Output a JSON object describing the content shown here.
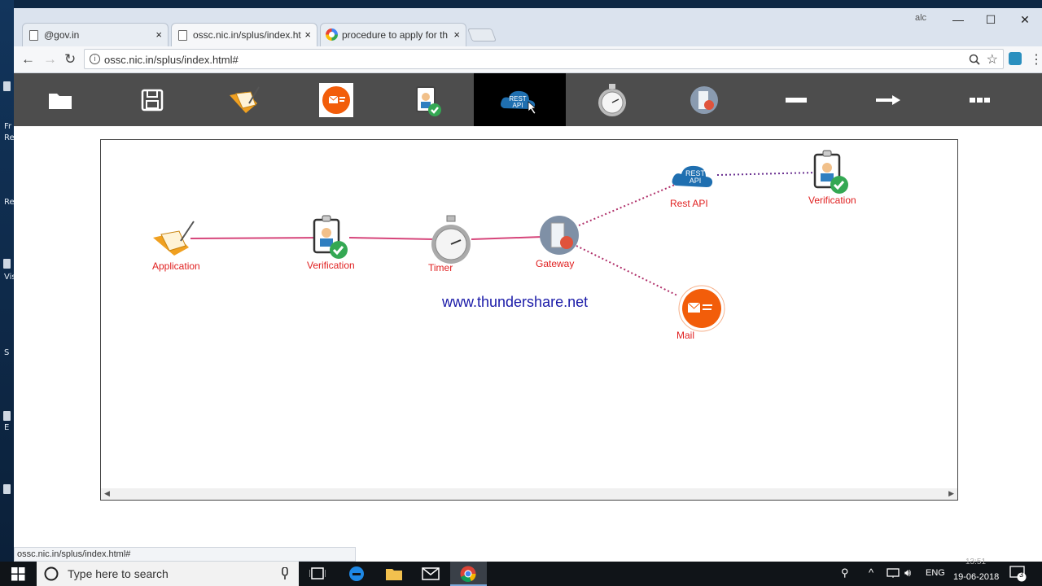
{
  "desktop": {
    "labels": [
      "Fr",
      "Re",
      "Re",
      "Vis",
      "S",
      "E"
    ]
  },
  "browser": {
    "tabs": [
      {
        "title": "@gov.in",
        "close": "×"
      },
      {
        "title": "ossc.nic.in/splus/index.ht",
        "close": "×"
      },
      {
        "title": "procedure to apply for th",
        "close": "×"
      }
    ],
    "window_controls": {
      "user": "alc",
      "minimize": "—",
      "maximize": "☐",
      "close": "✕"
    },
    "url": "ossc.nic.in/splus/index.html#",
    "status_url": "ossc.nic.in/splus/index.html#"
  },
  "toolbar": {
    "tools": [
      {
        "name": "open-folder",
        "icon": "folder-icon"
      },
      {
        "name": "save",
        "icon": "floppy-disk-icon"
      },
      {
        "name": "application",
        "icon": "folder-form-icon"
      },
      {
        "name": "mail",
        "icon": "mail-icon"
      },
      {
        "name": "verification",
        "icon": "badge-check-icon"
      },
      {
        "name": "rest-api",
        "icon": "rest-api-cloud-icon",
        "text": "REST API",
        "selected": true
      },
      {
        "name": "timer",
        "icon": "stopwatch-icon"
      },
      {
        "name": "gateway",
        "icon": "gateway-icon"
      },
      {
        "name": "line",
        "icon": "line-icon"
      },
      {
        "name": "arrow",
        "icon": "arrow-right-icon"
      },
      {
        "name": "dotted-line",
        "icon": "dotted-line-icon"
      }
    ]
  },
  "diagram": {
    "nodes": [
      {
        "id": "application",
        "label": "Application"
      },
      {
        "id": "verification1",
        "label": "Verification"
      },
      {
        "id": "timer",
        "label": "Timer"
      },
      {
        "id": "gateway",
        "label": "Gateway"
      },
      {
        "id": "restapi",
        "label": "Rest API",
        "icon_text": "REST API"
      },
      {
        "id": "verification2",
        "label": "Verification"
      },
      {
        "id": "mail",
        "label": "Mail"
      }
    ],
    "watermark": "www.thundershare.net"
  },
  "taskbar": {
    "search_placeholder": "Type here to search",
    "language": "ENG",
    "time": "13:51",
    "date": "19-06-2018",
    "notification_count": "3"
  },
  "colors": {
    "toolbar_bg": "#4d4d4d",
    "label_red": "#e02020",
    "solid_link": "#d6457a",
    "dotted_link": "#b0306a",
    "watermark": "#1a1aa8"
  }
}
